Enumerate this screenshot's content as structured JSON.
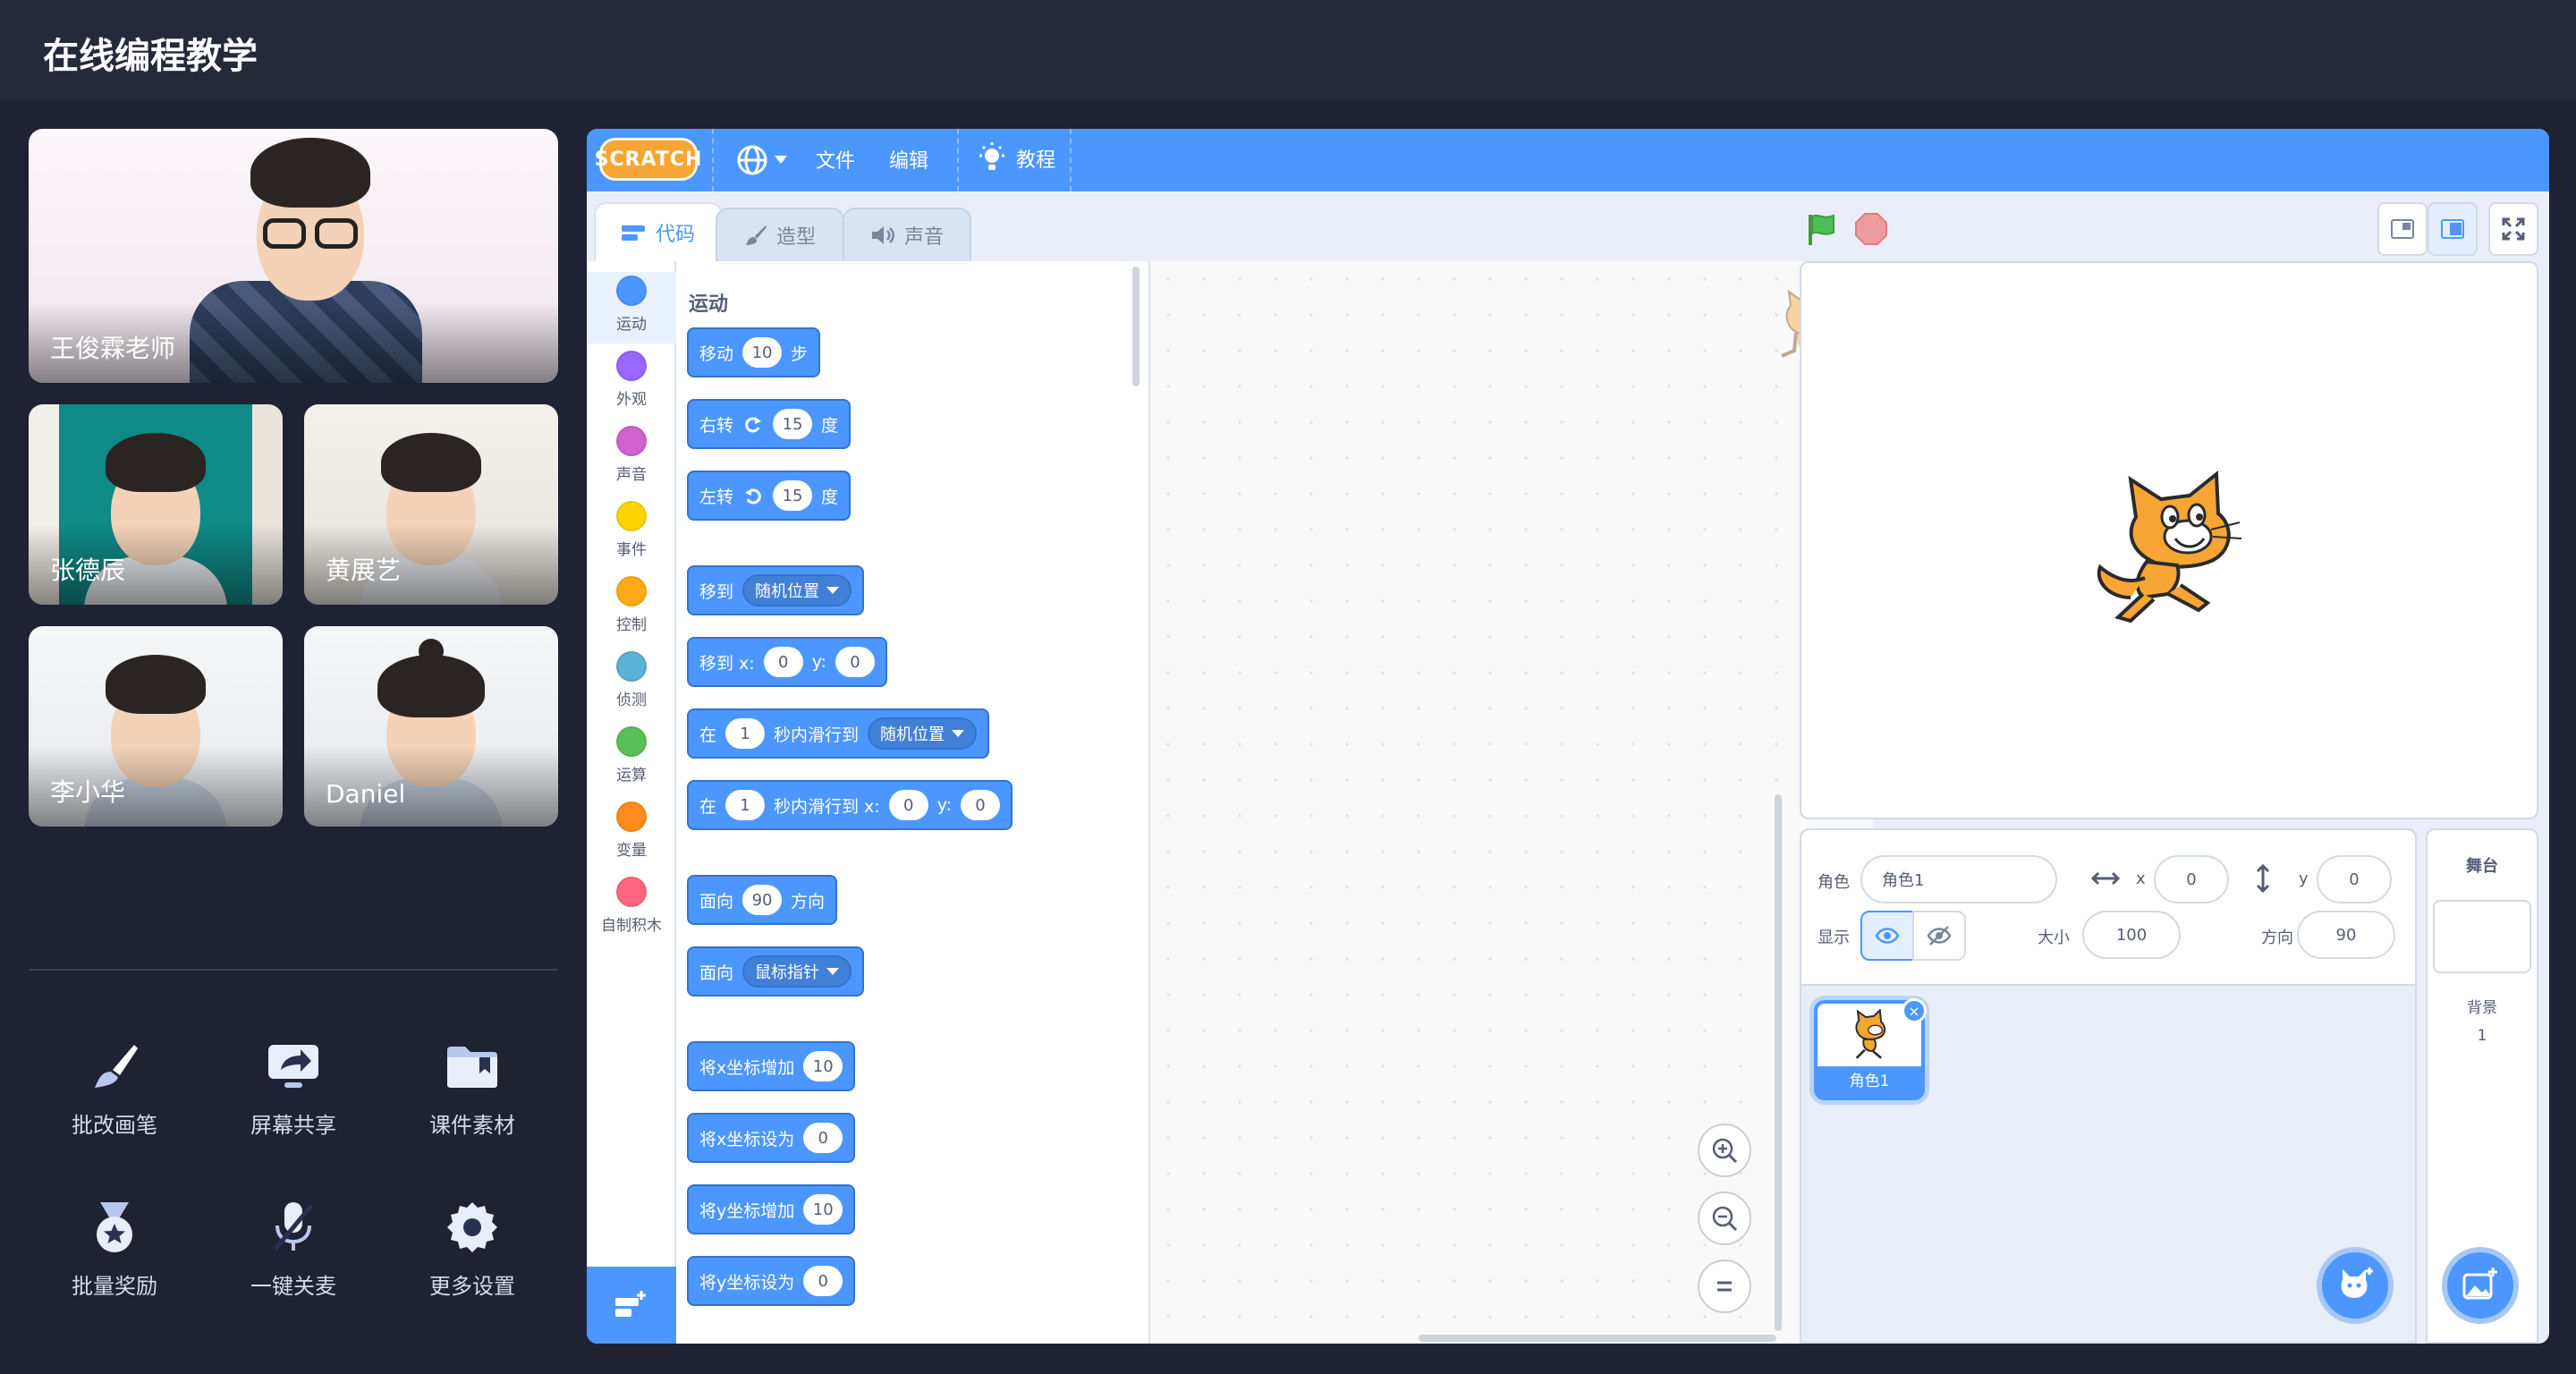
{
  "app": {
    "title": "在线编程教学"
  },
  "participants": {
    "teacher": {
      "name": "王俊霖老师"
    },
    "students": [
      {
        "name": "张德辰"
      },
      {
        "name": "黄展艺"
      },
      {
        "name": "李小华"
      },
      {
        "name": "Daniel"
      }
    ]
  },
  "tools": [
    {
      "label": "批改画笔",
      "icon": "brush-icon"
    },
    {
      "label": "屏幕共享",
      "icon": "screen-share-icon"
    },
    {
      "label": "课件素材",
      "icon": "folder-icon"
    },
    {
      "label": "批量奖励",
      "icon": "medal-icon"
    },
    {
      "label": "一键关麦",
      "icon": "mic-off-icon"
    },
    {
      "label": "更多设置",
      "icon": "gear-icon"
    }
  ],
  "scratch": {
    "logo": "SCRATCH",
    "menu": {
      "file": "文件",
      "edit": "编辑",
      "tutorials": "教程"
    },
    "tabs": {
      "code": "代码",
      "costumes": "造型",
      "sounds": "声音"
    },
    "categories": [
      {
        "label": "运动",
        "color": "#4c97ff"
      },
      {
        "label": "外观",
        "color": "#9966ff"
      },
      {
        "label": "声音",
        "color": "#cf63cf"
      },
      {
        "label": "事件",
        "color": "#ffd500"
      },
      {
        "label": "控制",
        "color": "#ffab19"
      },
      {
        "label": "侦测",
        "color": "#5cb1d6"
      },
      {
        "label": "运算",
        "color": "#59c059"
      },
      {
        "label": "变量",
        "color": "#ff8c1a"
      },
      {
        "label": "自制积木",
        "color": "#ff6680"
      }
    ],
    "palette_title": "运动",
    "blocks": {
      "move": {
        "a": "移动",
        "n": "10",
        "b": "步"
      },
      "turn_right": {
        "a": "右转",
        "n": "15",
        "b": "度"
      },
      "turn_left": {
        "a": "左转",
        "n": "15",
        "b": "度"
      },
      "goto": {
        "a": "移到",
        "opt": "随机位置"
      },
      "goto_xy": {
        "a": "移到 x:",
        "x": "0",
        "ylbl": "y:",
        "y": "0"
      },
      "glide": {
        "a": "在",
        "n": "1",
        "b": "秒内滑行到",
        "opt": "随机位置"
      },
      "glide_xy": {
        "a": "在",
        "n": "1",
        "b": "秒内滑行到 x:",
        "x": "0",
        "ylbl": "y:",
        "y": "0"
      },
      "point_dir": {
        "a": "面向",
        "n": "90",
        "b": "方向"
      },
      "point_towards": {
        "a": "面向",
        "opt": "鼠标指针"
      },
      "change_x": {
        "a": "将x坐标增加",
        "n": "10"
      },
      "set_x": {
        "a": "将x坐标设为",
        "n": "0"
      },
      "change_y": {
        "a": "将y坐标增加",
        "n": "10"
      },
      "set_y": {
        "a": "将y坐标设为",
        "n": "0"
      }
    },
    "sprite": {
      "label_sprite": "角色",
      "name": "角色1",
      "label_x": "x",
      "x": "0",
      "label_y": "y",
      "y": "0",
      "label_show": "显示",
      "label_size": "大小",
      "size": "100",
      "label_direction": "方向",
      "direction": "90"
    },
    "sprite_list": [
      {
        "name": "角色1"
      }
    ],
    "stage_panel": {
      "title": "舞台",
      "backdrops_label": "背景",
      "backdrops_count": "1"
    }
  }
}
